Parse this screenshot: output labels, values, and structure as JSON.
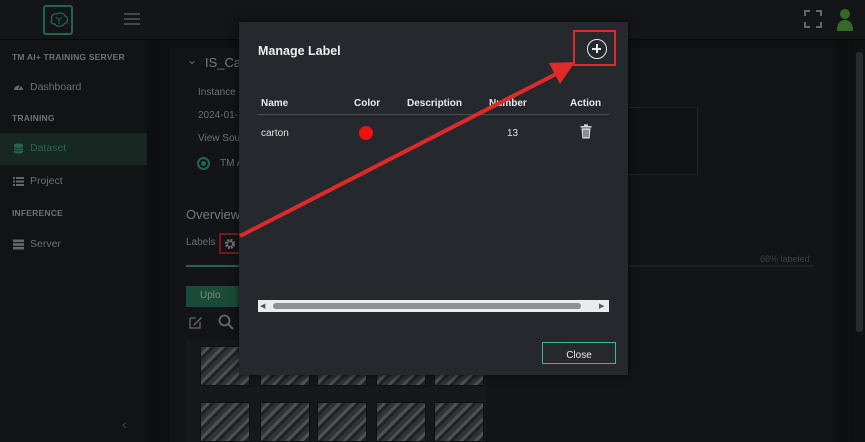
{
  "app": {
    "server_name": "TM AI+ TRAINING SERVER"
  },
  "sidebar": {
    "items": [
      {
        "type": "item",
        "label": "Dashboard",
        "icon": "dashboard-icon"
      },
      {
        "type": "heading",
        "label": "TRAINING"
      },
      {
        "type": "item",
        "label": "Dataset",
        "icon": "database-icon",
        "active": true
      },
      {
        "type": "item",
        "label": "Project",
        "icon": "list-icon"
      },
      {
        "type": "heading",
        "label": "INFERENCE"
      },
      {
        "type": "item",
        "label": "Server",
        "icon": "server-icon"
      }
    ]
  },
  "main": {
    "dataset_title": "IS_Car",
    "instance_label": "Instance",
    "date_partial": "2024-01-",
    "view_source_label": "View Sou",
    "radio_label": "TM A",
    "overview_title": "Overview",
    "labels_text": "Labels",
    "labeled_percent": "68% labeled",
    "labeled_fraction": 0.68,
    "upload_label": "Uplo"
  },
  "modal": {
    "title": "Manage Label",
    "columns": [
      "Name",
      "Color",
      "Description",
      "Number",
      "Action"
    ],
    "rows": [
      {
        "name": "carton",
        "color": "#f01010",
        "description": "",
        "number": "13",
        "action_icon": "trash-icon"
      }
    ],
    "close_label": "Close"
  },
  "colors": {
    "accent": "#3fb98a",
    "highlight": "#e02a2a",
    "label_color": "#f01010"
  }
}
